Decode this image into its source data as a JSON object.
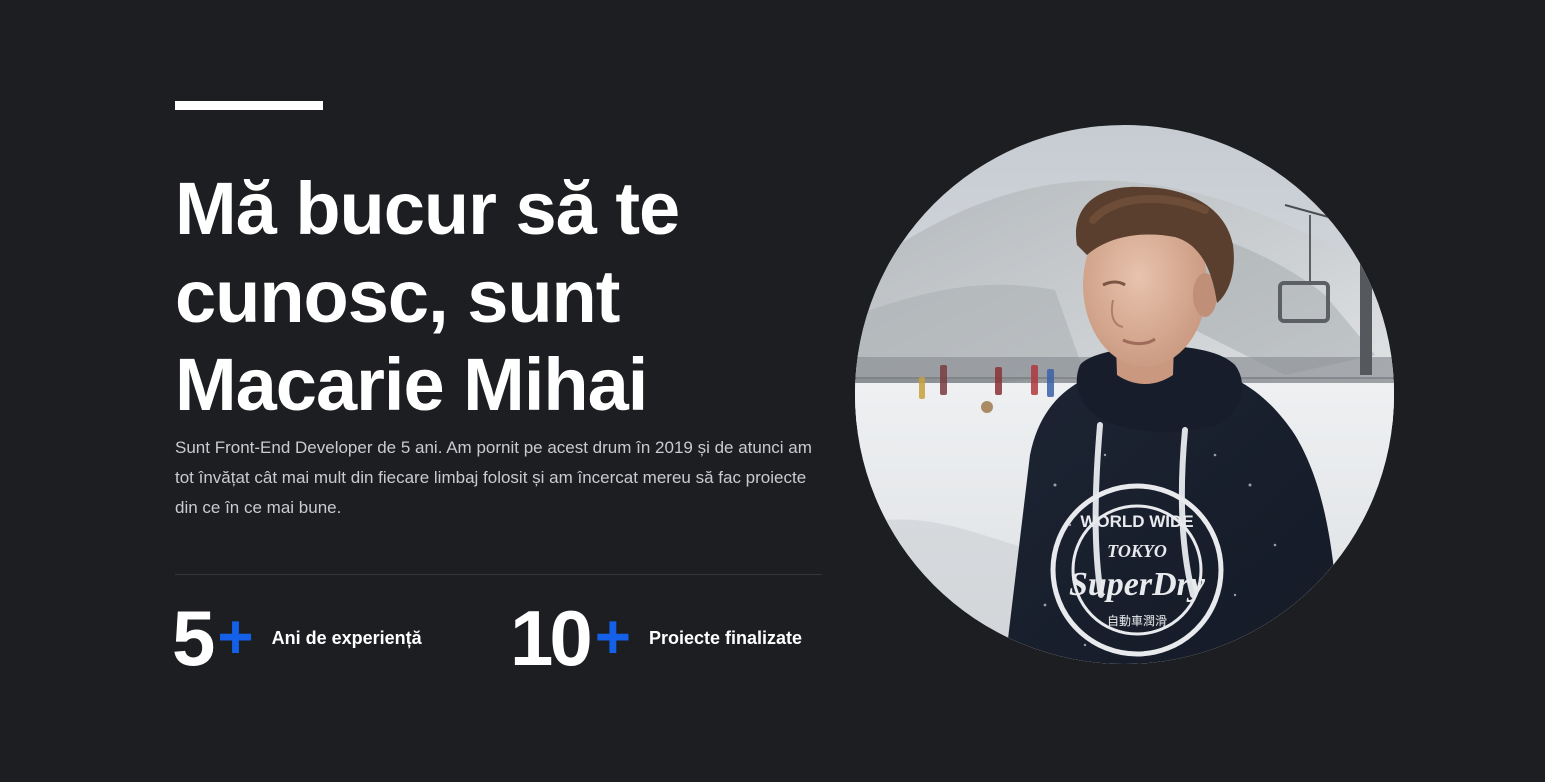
{
  "hero": {
    "headline": "Mă bucur să te cunosc, sunt Macarie Mihai",
    "bio": "Sunt Front-End Developer de 5 ani. Am pornit pe acest drum în 2019 și de atunci am tot învățat cât mai mult din fiecare limbaj folosit și am încercat mereu să fac proiecte din ce în ce mai bune."
  },
  "stats": [
    {
      "value": "5",
      "suffix": "+",
      "label": "Ani de experiență"
    },
    {
      "value": "10",
      "suffix": "+",
      "label": "Proiecte finalizate"
    }
  ],
  "colors": {
    "background": "#1c1e21",
    "accent": "#1560e8",
    "text": "#ffffff",
    "muted_text": "#c9cbd0"
  },
  "profile_photo": {
    "hoodie_text_top": "WORLD WIDE",
    "hoodie_text_mid": "TOKYO",
    "hoodie_text_brand": "SuperDry",
    "hoodie_text_bottom": "自動車潤滑"
  }
}
